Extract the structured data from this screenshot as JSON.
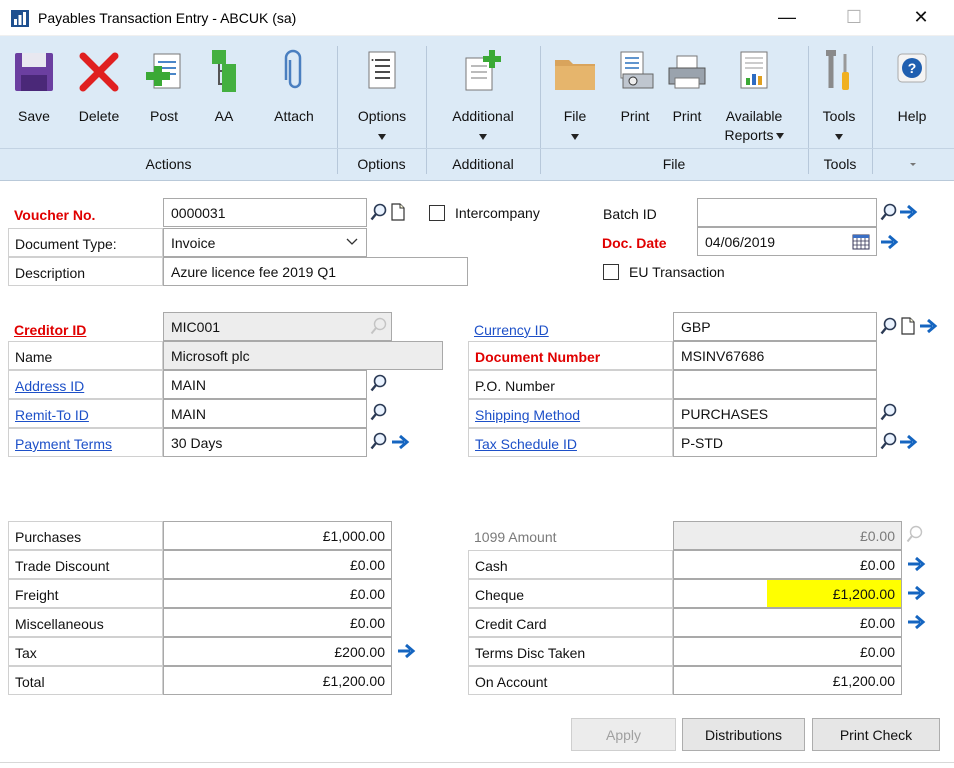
{
  "window": {
    "title": "Payables Transaction Entry  -  ABCUK (sa)",
    "minimize_glyph": "—",
    "maximize_glyph": "☐",
    "close_glyph": "✕"
  },
  "ribbon": {
    "buttons": {
      "save": "Save",
      "delete": "Delete",
      "post": "Post",
      "aa": "AA",
      "attach": "Attach",
      "options": "Options",
      "additional": "Additional",
      "file": "File",
      "print1": "Print",
      "print2": "Print",
      "available_reports_1": "Available",
      "available_reports_2": "Reports",
      "tools": "Tools",
      "help": "Help"
    },
    "groups": {
      "actions": "Actions",
      "options": "Options",
      "additional": "Additional",
      "file": "File",
      "tools": "Tools"
    }
  },
  "header": {
    "voucher_label": "Voucher No.",
    "voucher_value": "0000031",
    "intercompany_label": "Intercompany",
    "doc_type_label": "Document Type:",
    "doc_type_value": "Invoice",
    "description_label": "Description",
    "description_value": "Azure licence fee 2019 Q1",
    "batch_label": "Batch ID",
    "batch_value": "",
    "doc_date_label": "Doc. Date",
    "doc_date_value": "04/06/2019",
    "eu_label": "EU Transaction"
  },
  "creditor": {
    "creditor_id_label": "Creditor ID",
    "creditor_id_value": "MIC001",
    "name_label": "Name",
    "name_value": "Microsoft plc",
    "address_label": "Address ID",
    "address_value": "MAIN",
    "remit_label": "Remit-To ID",
    "remit_value": "MAIN",
    "terms_label": "Payment Terms",
    "terms_value": "30 Days",
    "currency_label": "Currency ID",
    "currency_value": "GBP",
    "docnum_label": "Document Number",
    "docnum_value": "MSINV67686",
    "po_label": "P.O. Number",
    "po_value": "",
    "shipping_label": "Shipping Method",
    "shipping_value": "PURCHASES",
    "taxsched_label": "Tax Schedule ID",
    "taxsched_value": "P-STD"
  },
  "amounts_left": [
    {
      "label": "Purchases",
      "value": "£1,000.00"
    },
    {
      "label": "Trade Discount",
      "value": "£0.00"
    },
    {
      "label": "Freight",
      "value": "£0.00"
    },
    {
      "label": "Miscellaneous",
      "value": "£0.00"
    },
    {
      "label": "Tax",
      "value": "£200.00"
    },
    {
      "label": "Total",
      "value": "£1,200.00"
    }
  ],
  "amounts_right": [
    {
      "label": "1099 Amount",
      "value": "£0.00"
    },
    {
      "label": "Cash",
      "value": "£0.00"
    },
    {
      "label": "Cheque",
      "value": "£1,200.00"
    },
    {
      "label": "Credit Card",
      "value": "£0.00"
    },
    {
      "label": "Terms Disc Taken",
      "value": "£0.00"
    },
    {
      "label": "On Account",
      "value": "£1,200.00"
    }
  ],
  "buttons": {
    "apply": "Apply",
    "distributions": "Distributions",
    "print_check": "Print Check"
  },
  "colors": {
    "required": "#e00000",
    "link": "#1d50c8",
    "highlight": "#ffff00",
    "ribbon": "#dceaf6"
  }
}
